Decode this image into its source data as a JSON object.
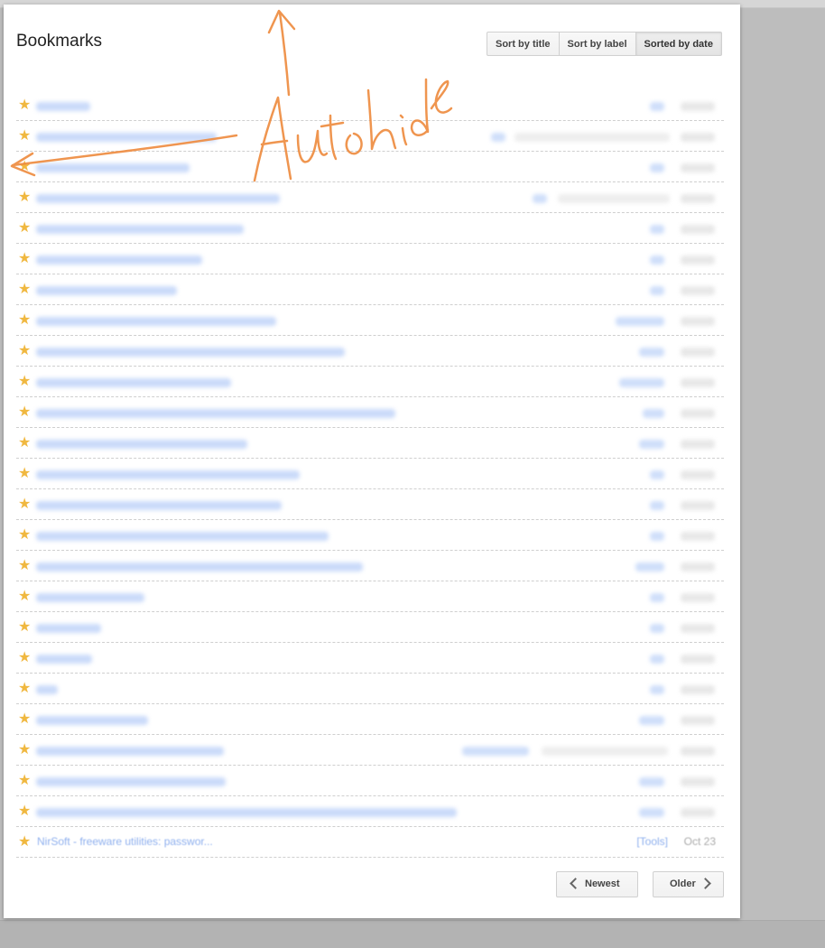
{
  "header": {
    "title": "Bookmarks"
  },
  "sort": {
    "title": "Sort by title",
    "label": "Sort by label",
    "date": "Sorted by date"
  },
  "last_row": {
    "title": "NirSoft - freeware utilities: passwor...",
    "label": "[Tools]",
    "date": "Oct 23"
  },
  "pager": {
    "newest": "Newest",
    "older": "Older"
  },
  "annotation": {
    "text": "Auto hide"
  },
  "colors": {
    "star": "#f0b840",
    "accent": "#ee8a3d",
    "link": "#8fb0ee"
  }
}
